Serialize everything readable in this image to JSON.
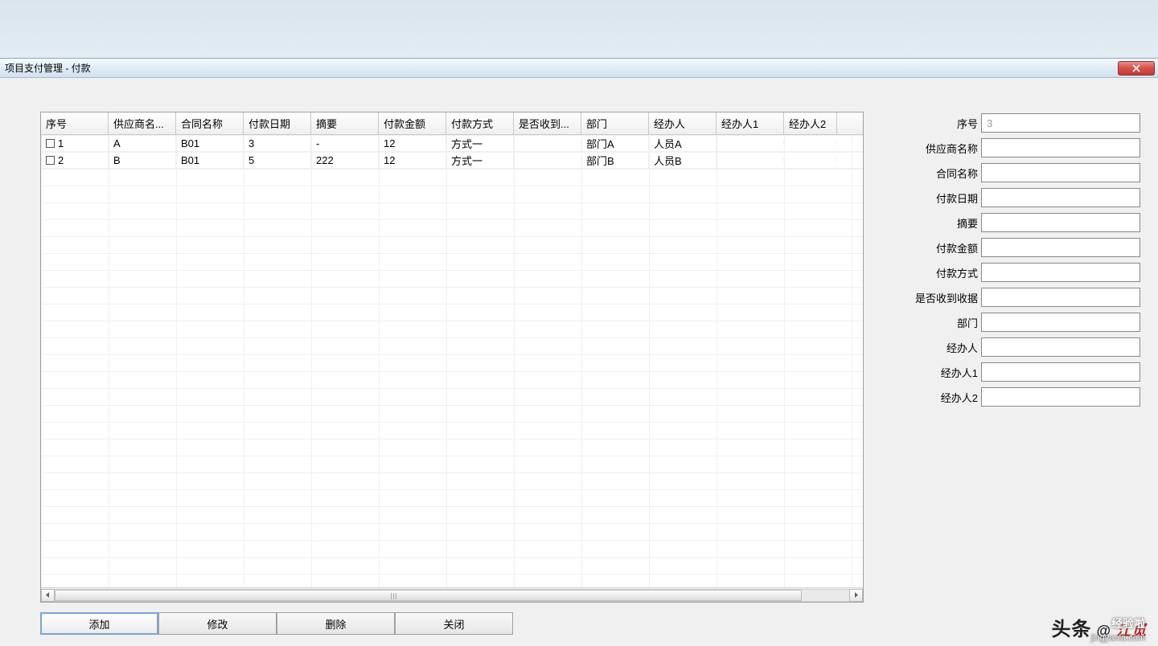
{
  "window": {
    "title": "项目支付管理  -  付款"
  },
  "table": {
    "headers": [
      "序号",
      "供应商名...",
      "合同名称",
      "付款日期",
      "摘要",
      "付款金额",
      "付款方式",
      "是否收到...",
      "部门",
      "经办人",
      "经办人1",
      "经办人2"
    ],
    "rows": [
      {
        "seq": "1",
        "supplier": "A",
        "contract": "B01",
        "paydate": "3",
        "summary": "-",
        "amount": "12",
        "method": "方式一",
        "received": "",
        "dept": "部门A",
        "handler": "人员A",
        "handler1": "",
        "handler2": ""
      },
      {
        "seq": "2",
        "supplier": "B",
        "contract": "B01",
        "paydate": "5",
        "summary": "222",
        "amount": "12",
        "method": "方式一",
        "received": "",
        "dept": "部门B",
        "handler": "人员B",
        "handler1": "",
        "handler2": ""
      }
    ]
  },
  "form": {
    "fields": {
      "seq": {
        "label": "序号",
        "value": "",
        "placeholder": "3"
      },
      "supplier": {
        "label": "供应商名称",
        "value": "",
        "placeholder": ""
      },
      "contract": {
        "label": "合同名称",
        "value": "",
        "placeholder": ""
      },
      "paydate": {
        "label": "付款日期",
        "value": "",
        "placeholder": ""
      },
      "summary": {
        "label": "摘要",
        "value": "",
        "placeholder": ""
      },
      "amount": {
        "label": "付款金额",
        "value": "",
        "placeholder": ""
      },
      "method": {
        "label": "付款方式",
        "value": "",
        "placeholder": ""
      },
      "received": {
        "label": "是否收到收据",
        "value": "",
        "placeholder": ""
      },
      "dept": {
        "label": "部门",
        "value": "",
        "placeholder": ""
      },
      "handler": {
        "label": "经办人",
        "value": "",
        "placeholder": ""
      },
      "handler1": {
        "label": "经办人1",
        "value": "",
        "placeholder": ""
      },
      "handler2": {
        "label": "经办人2",
        "value": "",
        "placeholder": ""
      }
    }
  },
  "buttons": {
    "add": "添加",
    "edit": "修改",
    "delete": "删除",
    "close": "关闭"
  },
  "watermark": {
    "a": "头条",
    "b": "@",
    "c": "江觅",
    "d": "经验啦",
    "site": "jingyanla.com"
  }
}
